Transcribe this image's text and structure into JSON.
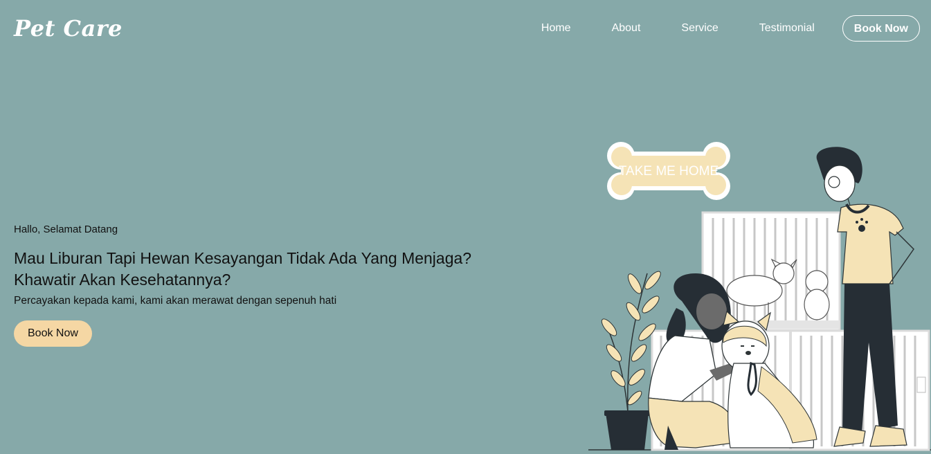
{
  "header": {
    "logo": "Pet Care",
    "nav": [
      "Home",
      "About",
      "Service",
      "Testimonial"
    ],
    "book_button": "Book Now"
  },
  "hero": {
    "greeting": "Hallo, Selamat Datang",
    "headline_line1": "Mau Liburan Tapi Hewan Kesayangan Tidak Ada Yang Menjaga?",
    "headline_line2": "Khawatir Akan Kesehatannya?",
    "subtext": "Percayakan kepada kami, kami akan merawat dengan sepenuh hati",
    "cta": "Book Now",
    "sign_text": "TAKE ME HOME"
  },
  "colors": {
    "background": "#86a9a9",
    "accent": "#f5d7a4",
    "dark": "#262e35"
  }
}
